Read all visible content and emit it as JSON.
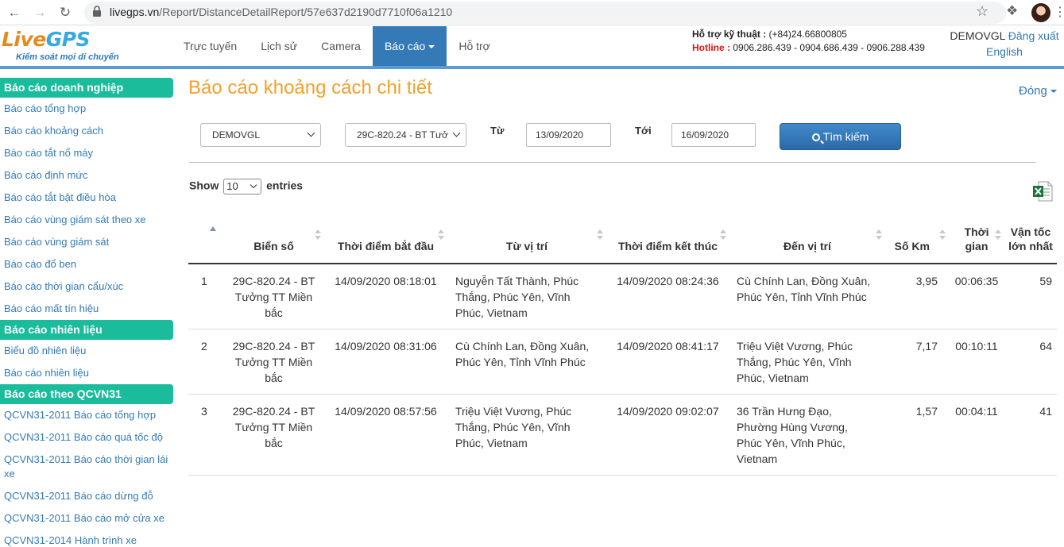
{
  "browser": {
    "url_domain": "livegps.vn",
    "url_path": "/Report/DistanceDetailReport/57e637d2190d7710f06a1210"
  },
  "header": {
    "logo_live": "Live",
    "logo_gps": "GPS",
    "logo_tagline": "Kiểm soát mọi di chuyển",
    "nav": [
      "Trực tuyến",
      "Lịch sử",
      "Camera",
      "Báo cáo",
      "Hỗ trợ"
    ],
    "support_label": "Hỗ trợ kỹ thuật :",
    "support_phone": "(+84)24.66800805",
    "hotline_label": "Hotline :",
    "hotline_phones": "0906.286.439 - 0904.686.439 - 0906.288.439",
    "username": "DEMOVGL",
    "logout": "Đăng xuất",
    "language": "English"
  },
  "sidebar": [
    {
      "heading": "Báo cáo doanh nghiệp",
      "items": [
        "Báo cáo tổng hợp",
        "Báo cáo khoảng cách",
        "Báo cáo tắt nổ máy",
        "Báo cáo định mức",
        "Báo cáo tắt bật điều hòa",
        "Báo cáo vùng giám sát theo xe",
        "Báo cáo vùng giám sát",
        "Báo cáo đổ ben",
        "Báo cáo thời gian cẩu/xúc",
        "Báo cáo mất tín hiệu"
      ]
    },
    {
      "heading": "Báo cáo nhiên liệu",
      "items": [
        "Biểu đồ nhiên liệu",
        "Báo cáo nhiên liệu"
      ]
    },
    {
      "heading": "Báo cáo theo QCVN31",
      "items": [
        "QCVN31-2011 Báo cáo tổng hợp",
        "QCVN31-2011 Báo cáo quá tốc độ",
        "QCVN31-2011 Báo cáo thời gian lái xe",
        "QCVN31-2011 Báo cáo dừng đỗ",
        "QCVN31-2011 Báo cáo mở cửa xe",
        "QCVN31-2014 Hành trình xe"
      ]
    }
  ],
  "main": {
    "title": "Báo cáo khoảng cách chi tiết",
    "close": "Đóng",
    "filters": {
      "company": "DEMOVGL",
      "vehicle": "29C-820.24 - BT Tưở",
      "from_label": "Từ",
      "from_date": "13/09/2020",
      "to_label": "Tới",
      "to_date": "16/09/2020",
      "search": "Tìm kiếm"
    },
    "show_label": "Show",
    "page_length": "10",
    "entries_label": "entries"
  },
  "table": {
    "columns": [
      "",
      "Biển số",
      "Thời điểm bắt đầu",
      "Từ vị trí",
      "Thời điểm kết thúc",
      "Đến vị trí",
      "Số Km",
      "Thời gian",
      "Vận tốc lớn nhất"
    ],
    "rows": [
      [
        "1",
        "29C-820.24 - BT Tưởng TT Miền bắc",
        "14/09/2020 08:18:01",
        "Nguyễn Tất Thành, Phúc Thắng, Phúc Yên, Vĩnh Phúc, Vietnam",
        "14/09/2020 08:24:36",
        "Cù Chính Lan, Đồng Xuân, Phúc Yên, Tỉnh Vĩnh Phúc",
        "3,95",
        "00:06:35",
        "59"
      ],
      [
        "2",
        "29C-820.24 - BT Tưởng TT Miền bắc",
        "14/09/2020 08:31:06",
        "Cù Chính Lan, Đồng Xuân, Phúc Yên, Tỉnh Vĩnh Phúc",
        "14/09/2020 08:41:17",
        "Triệu Việt Vương, Phúc Thắng, Phúc Yên, Vĩnh Phúc, Vietnam",
        "7,17",
        "00:10:11",
        "64"
      ],
      [
        "3",
        "29C-820.24 - BT Tưởng TT Miền bắc",
        "14/09/2020 08:57:56",
        "Triệu Việt Vương, Phúc Thắng, Phúc Yên, Vĩnh Phúc, Vietnam",
        "14/09/2020 09:02:07",
        "36 Trần Hưng Đạo, Phường Hùng Vương, Phúc Yên, Vĩnh Phúc, Vietnam",
        "1,57",
        "00:04:11",
        "41"
      ]
    ]
  }
}
